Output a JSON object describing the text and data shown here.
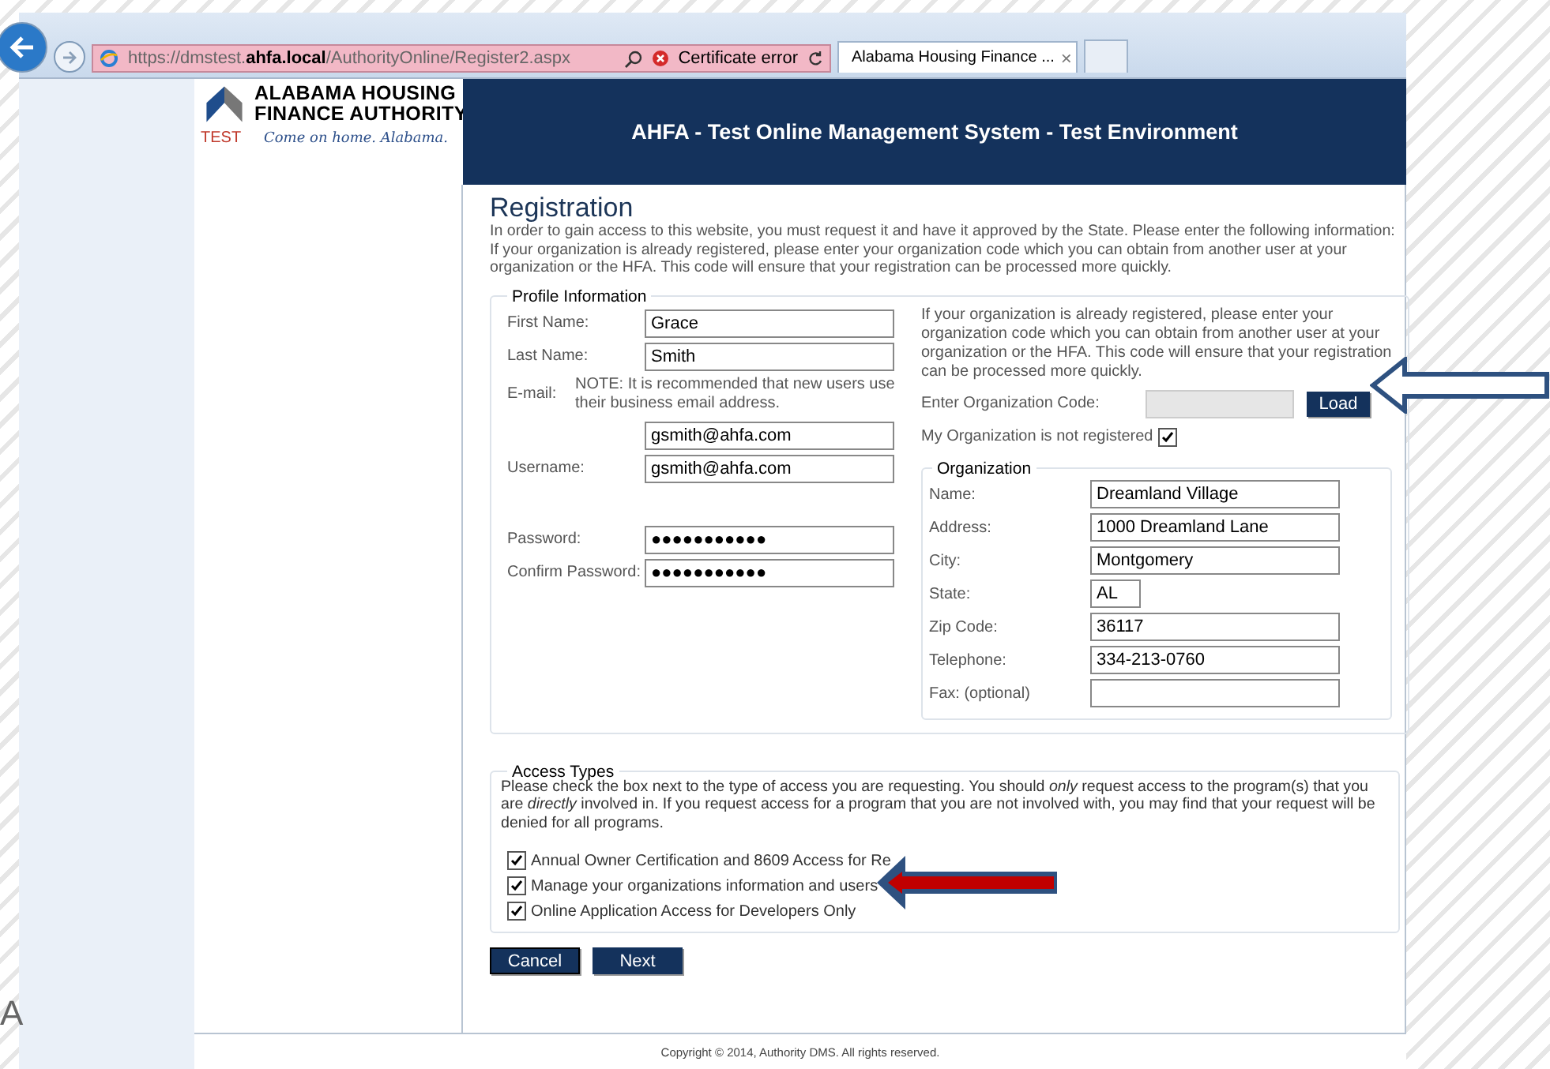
{
  "browser": {
    "url": "https://dmstest.**ahfa.local**/AuthorityOnline/Register2.aspx",
    "certificate_error": "Certificate error",
    "tab": {
      "title": "Alabama Housing Finance ...",
      "close": "×",
      "selected": true
    }
  },
  "logo": {
    "line_1": "ALABAMA HOUSING",
    "line_2": "FINANCE AUTHORITY",
    "badge": "TEST",
    "tagline": "Come on home. Alabama."
  },
  "header": {
    "title": "AHFA - Test Online Management System - Test Environment"
  },
  "registration": {
    "title": "Registration",
    "intro": "In order to gain access to this website, you must request it and have it approved by the State. Please enter the following information: If your organization is already registered, please enter your organization code which you can obtain from another user at your organization or the HFA. This code will ensure that your registration can be processed more quickly."
  },
  "profile": {
    "legend": "Profile Information",
    "fields": [
      {
        "kind": "text",
        "label": "First Name:",
        "value": "Grace"
      },
      {
        "kind": "text",
        "label": "Last Name:",
        "value": "Smith"
      },
      {
        "kind": "email",
        "label": "E-mail:",
        "note": "NOTE: It is recommended that new users use their business email address.",
        "value": "gsmith@ahfa.com"
      },
      {
        "kind": "text",
        "label": "Username:",
        "value": "gsmith@ahfa.com"
      },
      {
        "kind": "password",
        "label": "Password:",
        "value": "●●●●●●●●●●●"
      },
      {
        "kind": "password",
        "label": "Confirm Password:",
        "value": "●●●●●●●●●●●"
      }
    ]
  },
  "org_code": {
    "note": "If your organization is already registered, please enter your organization code which you can obtain from another user at your organization or the HFA. This code will ensure that your registration can be processed more quickly.",
    "label": "Enter Organization Code:",
    "disabled": true,
    "button": "Load",
    "not_registered": {
      "label": "My Organization is not registered",
      "checked": true
    }
  },
  "organization": {
    "legend": "Organization",
    "fields": [
      {
        "kind": "wide",
        "label": "Name:",
        "value": "Dreamland Village"
      },
      {
        "kind": "wide",
        "label": "Address:",
        "value": "1000 Dreamland Lane"
      },
      {
        "kind": "wide",
        "label": "City:",
        "value": "Montgomery"
      },
      {
        "kind": "short",
        "label": "State:",
        "value": "AL"
      },
      {
        "kind": "wide",
        "label": "Zip Code:",
        "value": "36117"
      },
      {
        "kind": "wide",
        "label": "Telephone:",
        "value": "334-213-0760"
      },
      {
        "kind": "wide",
        "label": "Fax: (optional)"
      }
    ]
  },
  "access": {
    "legend": "Access Types",
    "intro": "Please check the box next to the type of access you are requesting. You should *only* request access to the program(s) that you are *directly* involved in. If you request access for a program that you are not involved with, you may find that your request will be denied for all programs.",
    "options": [
      {
        "label": "Annual Owner Certification and 8609 Access for Re",
        "checked": true
      },
      {
        "label": "Manage your organizations information and users",
        "checked": true
      },
      {
        "label": "Online Application Access for Developers Only",
        "checked": true
      }
    ]
  },
  "buttons": [
    {
      "label": "Cancel",
      "focused": true
    },
    {
      "label": "Next",
      "focused": false
    }
  ],
  "footer": {
    "copyright": "Copyright © 2014, Authority DMS. All rights reserved."
  },
  "slide": {
    "letter": "A"
  }
}
